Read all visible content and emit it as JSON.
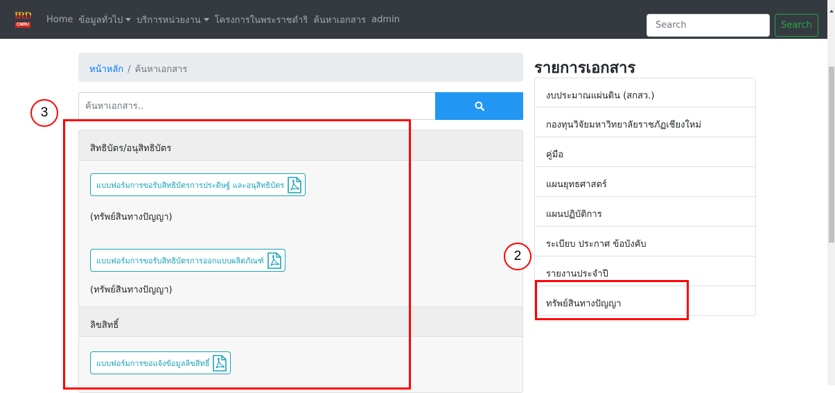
{
  "navbar": {
    "logo_top": "IRD",
    "logo_bottom": "CMRU",
    "items": [
      {
        "label": "Home",
        "dropdown": false
      },
      {
        "label": "ข้อมูลทั่วไป",
        "dropdown": true
      },
      {
        "label": "บริการหน่วยงาน",
        "dropdown": true
      },
      {
        "label": "โครงการในพระราชดำริ",
        "dropdown": false
      },
      {
        "label": "ค้นหาเอกสาร",
        "dropdown": false
      },
      {
        "label": "admin",
        "dropdown": false
      }
    ],
    "search_placeholder": "Search",
    "search_button": "Search"
  },
  "breadcrumb": {
    "home": "หน้าหลัก",
    "separator": "/",
    "current": "ค้นหาเอกสาร"
  },
  "doc_search": {
    "placeholder": "ค้นหาเอกสาร.."
  },
  "sections": [
    {
      "header": "สิทธิบัตร/อนุสิทธิบัตร",
      "documents": [
        {
          "label": "แบบฟอร์มการขอรับสิทธิบัตรการประดิษฐ์ และอนุสิทธิบัตร",
          "category": "(ทรัพย์สินทางปัญญา)"
        },
        {
          "label": "แบบฟอร์มการขอรับสิทธิบัตรการออกแบบผลิตภัณฑ์",
          "category": "(ทรัพย์สินทางปัญญา)"
        }
      ]
    },
    {
      "header": "ลิขสิทธิ์",
      "documents": [
        {
          "label": "แบบฟอร์มการขอแจ้งข้อมูลลิขสิทธิ์",
          "category": ""
        }
      ]
    }
  ],
  "sidebar": {
    "title": "รายการเอกสาร",
    "items": [
      "งบประมาณแผ่นดิน (สกสว.)",
      "กองทุนวิจัยมหาวิทยาลัยราชภัฏเชียงใหม่",
      "คู่มือ",
      "แผนยุทธศาสตร์",
      "แผนปฏิบัติการ",
      "ระเบียบ ประกาศ ข้อบังคับ",
      "รายงานประจำปี",
      "ทรัพย์สินทางปัญญา"
    ]
  },
  "annotations": {
    "marker_left": "3",
    "marker_right": "2",
    "color": "#ff0000"
  },
  "colors": {
    "navbar_bg": "#343a40",
    "search_btn": "#28a745",
    "doc_search_btn": "#2196f3",
    "link": "#007bff",
    "pdf_button": "#17a2b8"
  }
}
